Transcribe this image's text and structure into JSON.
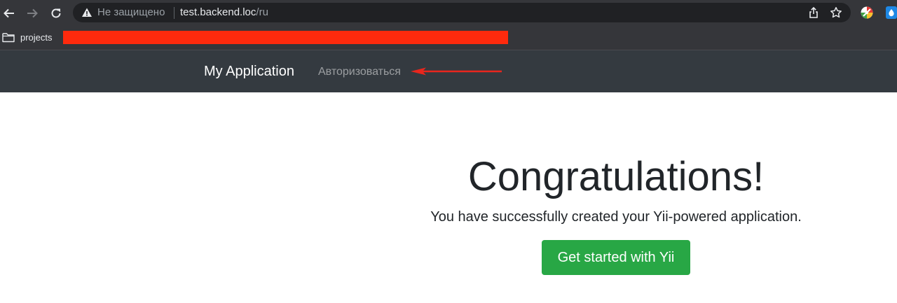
{
  "browser": {
    "security_status": "Не защищено",
    "url_host": "test.backend.loc",
    "url_path": "/ru",
    "icons": {
      "back": "back-arrow-icon",
      "forward": "forward-arrow-icon",
      "reload": "reload-icon",
      "warning": "warning-triangle-icon",
      "share": "share-icon",
      "bookmark_star": "star-icon"
    },
    "bookmarks_bar": {
      "items": [
        {
          "label": "projects",
          "icon": "folder-icon"
        }
      ],
      "redaction_color": "#ff2a0d"
    }
  },
  "navbar": {
    "brand": "My Application",
    "links": [
      {
        "label": "Авторизоваться"
      }
    ],
    "background": "#343a40"
  },
  "hero": {
    "title": "Congratulations!",
    "lead": "You have successfully created your Yii-powered application.",
    "button_label": "Get started with Yii",
    "button_color": "#28a745"
  },
  "annotation": {
    "arrow_color": "#e8261d"
  }
}
